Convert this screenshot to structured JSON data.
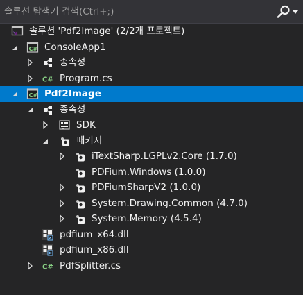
{
  "search": {
    "placeholder": "솔루션 탐색기 검색(Ctrl+;)"
  },
  "tree": [
    {
      "label": "솔루션 'Pdf2Image' (2/2개 프로젝트)",
      "icon": "solution-icon",
      "level": 0,
      "arrow": "none",
      "name": "solution"
    },
    {
      "label": "ConsoleApp1",
      "icon": "csharp-project-icon",
      "level": 1,
      "arrow": "expanded",
      "name": "project-consoleapp1"
    },
    {
      "label": "종속성",
      "icon": "dependencies-icon",
      "level": 2,
      "arrow": "collapsed",
      "name": "dependencies-consoleapp1"
    },
    {
      "label": "Program.cs",
      "icon": "csharp-file-icon",
      "level": 2,
      "arrow": "collapsed",
      "name": "file-program-cs"
    },
    {
      "label": "Pdf2Image",
      "icon": "csharp-project-icon",
      "level": 1,
      "arrow": "expanded",
      "name": "project-pdf2image",
      "selected": true
    },
    {
      "label": "종속성",
      "icon": "dependencies-icon",
      "level": 2,
      "arrow": "expanded",
      "name": "dependencies-pdf2image"
    },
    {
      "label": "SDK",
      "icon": "sdk-icon",
      "level": 3,
      "arrow": "collapsed",
      "name": "sdk"
    },
    {
      "label": "패키지",
      "icon": "package-icon",
      "level": 3,
      "arrow": "expanded",
      "name": "packages"
    },
    {
      "label": "iTextSharp.LGPLv2.Core (1.7.0)",
      "icon": "package-icon",
      "level": 4,
      "arrow": "collapsed",
      "name": "package-itextsharp"
    },
    {
      "label": "PDFium.Windows (1.0.0)",
      "icon": "package-icon",
      "level": 4,
      "arrow": "none",
      "name": "package-pdfium-windows"
    },
    {
      "label": "PDFiumSharpV2 (1.0.0)",
      "icon": "package-icon",
      "level": 4,
      "arrow": "collapsed",
      "name": "package-pdfiumsharpv2"
    },
    {
      "label": "System.Drawing.Common (4.7.0)",
      "icon": "package-icon",
      "level": 4,
      "arrow": "collapsed",
      "name": "package-system-drawing-common"
    },
    {
      "label": "System.Memory (4.5.4)",
      "icon": "package-icon",
      "level": 4,
      "arrow": "collapsed",
      "name": "package-system-memory"
    },
    {
      "label": "pdfium_x64.dll",
      "icon": "dll-file-icon",
      "level": 2,
      "arrow": "none",
      "name": "file-pdfium-x64-dll"
    },
    {
      "label": "pdfium_x86.dll",
      "icon": "dll-file-icon",
      "level": 2,
      "arrow": "none",
      "name": "file-pdfium-x86-dll"
    },
    {
      "label": "PdfSplitter.cs",
      "icon": "csharp-file-icon",
      "level": 2,
      "arrow": "collapsed",
      "name": "file-pdfsplitter-cs"
    }
  ],
  "colors": {
    "background": "#252526",
    "selection": "#007acc",
    "text": "#f1f1f1",
    "csharp_green": "#388a34",
    "solution_purple": "#68217a"
  }
}
